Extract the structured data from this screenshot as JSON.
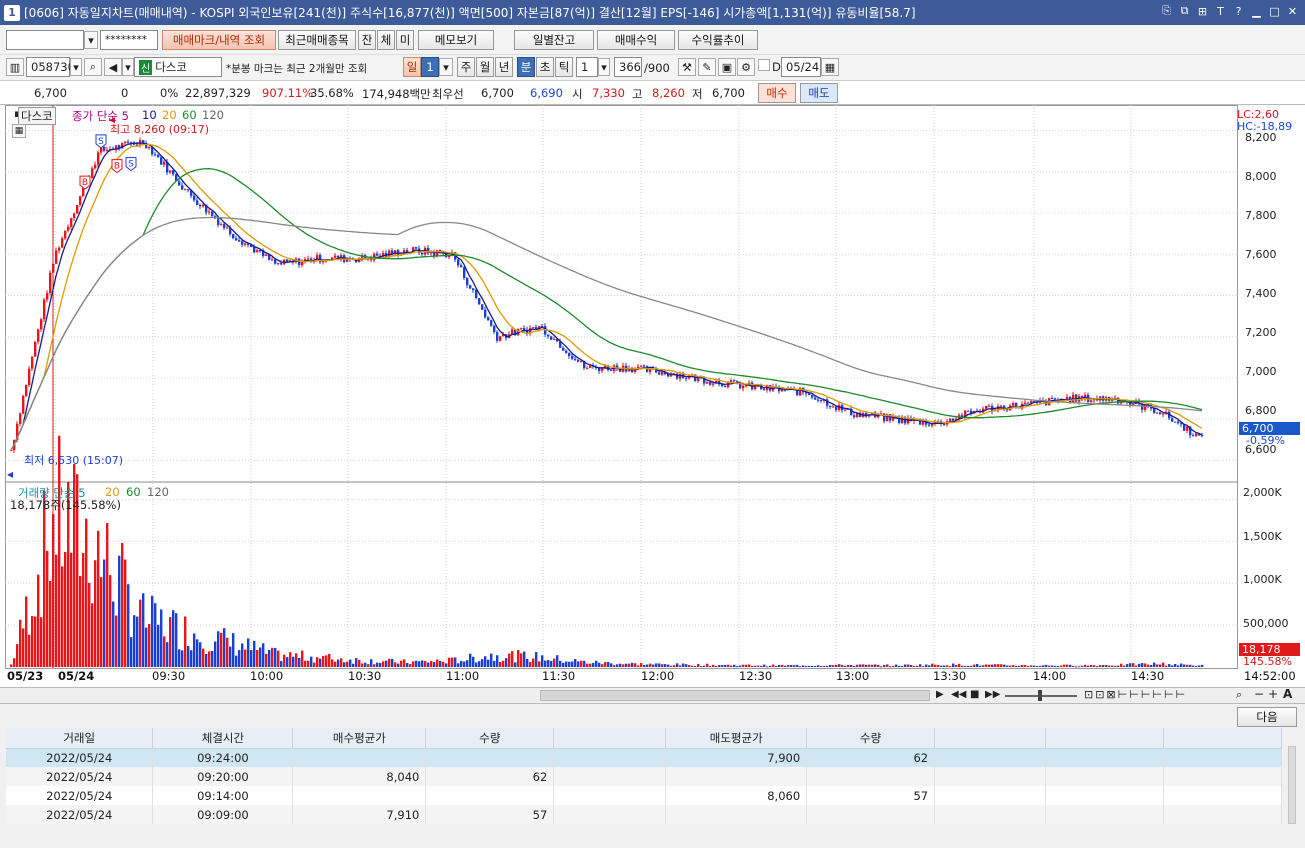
{
  "window": {
    "number": "1",
    "title": "[0606] 자동일지차트(매매내역) - KOSPI 외국인보유[241(천)] 주식수[16,877(천)] 액면[500] 자본금[87(억)] 결산[12월] EPS[-146] 시가총액[1,131(억)] 유동비율[58.7]"
  },
  "toolbar1": {
    "account_value": "",
    "password_value": "********",
    "buttons": [
      "매매마크/내역 조회",
      "최근매매종목",
      "잔",
      "체",
      "미",
      "메모보기",
      "일별잔고",
      "매매수익",
      "수익률추이"
    ]
  },
  "toolbar2": {
    "stock_code": "058730",
    "stock_name": "다스코",
    "stock_badge": "신",
    "notice": "*분봉 마크는 최근 2개월만 조회",
    "periods": [
      "일",
      "1",
      "주",
      "월",
      "년",
      "분",
      "초",
      "틱"
    ],
    "tick_value": "1",
    "count": "366",
    "count_max": "/900",
    "date": "05/24"
  },
  "quote": {
    "price": "6,700",
    "change": "0",
    "change_pct": "0%",
    "volume": "22,897,329",
    "vol_ratio": "907.11%",
    "turnover": "35.68%",
    "amount": "174,948백만",
    "best_label": "최우선",
    "best_sell": "6,700",
    "best_buy": "6,690",
    "open_label": "시",
    "open": "7,330",
    "high_label": "고",
    "high": "8,260",
    "low_label": "저",
    "low": "6,700",
    "buy_button": "매수",
    "sell_button": "매도"
  },
  "chart": {
    "stock_tag": "다스코",
    "legend_price": [
      "종가 단순 5",
      "10",
      "20",
      "60",
      "120"
    ],
    "high_mark": "최고 8,260 (09:17)",
    "low_mark": "최저 6,530 (15:07)",
    "lc": "LC:2,60",
    "hc": "HC:-18,89",
    "price_axis": [
      "8,200",
      "8,000",
      "7,800",
      "7,600",
      "7,400",
      "7,200",
      "7,000",
      "6,800",
      "6,600"
    ],
    "last_price": "6,700",
    "last_pct": "-0.59%",
    "volume_legend": [
      "거래량 단순 5",
      "20",
      "60",
      "120"
    ],
    "volume_info": "18,178주(145.58%)",
    "volume_axis": [
      "2,000K",
      "1,500K",
      "1,000K",
      "500,000"
    ],
    "last_volume": "18,178",
    "last_volume_pct": "145.58%",
    "x_labels": [
      "05/23",
      "05/24",
      "09:30",
      "10:00",
      "10:30",
      "11:00",
      "11:30",
      "12:00",
      "12:30",
      "13:00",
      "13:30",
      "14:00",
      "14:30",
      "14:52:00"
    ],
    "trade_marks": [
      "S",
      "B",
      "B",
      "S"
    ],
    "colors": {
      "up": "#e8161a",
      "down": "#1a3fd4",
      "ma5": "#1a1a8a",
      "ma10": "#e09a00",
      "ma20": "#1f8a2a",
      "ma120": "#888888"
    }
  },
  "chart_data": {
    "type": "candlestick",
    "x": [
      "05/23",
      "09:00",
      "09:10",
      "09:17",
      "09:30",
      "09:45",
      "10:00",
      "10:15",
      "10:30",
      "10:45",
      "11:00",
      "11:10",
      "11:20",
      "11:30",
      "11:45",
      "12:00",
      "12:15",
      "12:30",
      "12:45",
      "13:00",
      "13:15",
      "13:30",
      "13:45",
      "14:00",
      "14:15",
      "14:30",
      "14:45",
      "14:52"
    ],
    "close": [
      6650,
      7600,
      8100,
      8150,
      7900,
      7700,
      7550,
      7580,
      7580,
      7620,
      7600,
      7200,
      7250,
      7050,
      7050,
      7020,
      6980,
      6950,
      6930,
      6830,
      6800,
      6780,
      6850,
      6870,
      6900,
      6900,
      6840,
      6700
    ],
    "volume_k": [
      30,
      1900,
      1450,
      600,
      450,
      300,
      150,
      120,
      80,
      60,
      80,
      150,
      120,
      60,
      40,
      30,
      25,
      20,
      20,
      25,
      20,
      30,
      25,
      20,
      20,
      25,
      40,
      18
    ],
    "ylim": [
      6500,
      8300
    ],
    "volume_ylim": [
      0,
      2100
    ]
  },
  "scrollbar": {
    "next_button": "다음"
  },
  "grid": {
    "headers": [
      "거래일",
      "체결시간",
      "매수평균가",
      "수량",
      "",
      "매도평균가",
      "수량",
      "",
      "",
      ""
    ],
    "rows": [
      [
        "2022/05/24",
        "09:24:00",
        "",
        "",
        "",
        "7,900",
        "62",
        "",
        "",
        ""
      ],
      [
        "2022/05/24",
        "09:20:00",
        "8,040",
        "62",
        "",
        "",
        "",
        "",
        "",
        ""
      ],
      [
        "2022/05/24",
        "09:14:00",
        "",
        "",
        "",
        "8,060",
        "57",
        "",
        "",
        ""
      ],
      [
        "2022/05/24",
        "09:09:00",
        "7,910",
        "57",
        "",
        "",
        "",
        "",
        "",
        ""
      ]
    ]
  }
}
